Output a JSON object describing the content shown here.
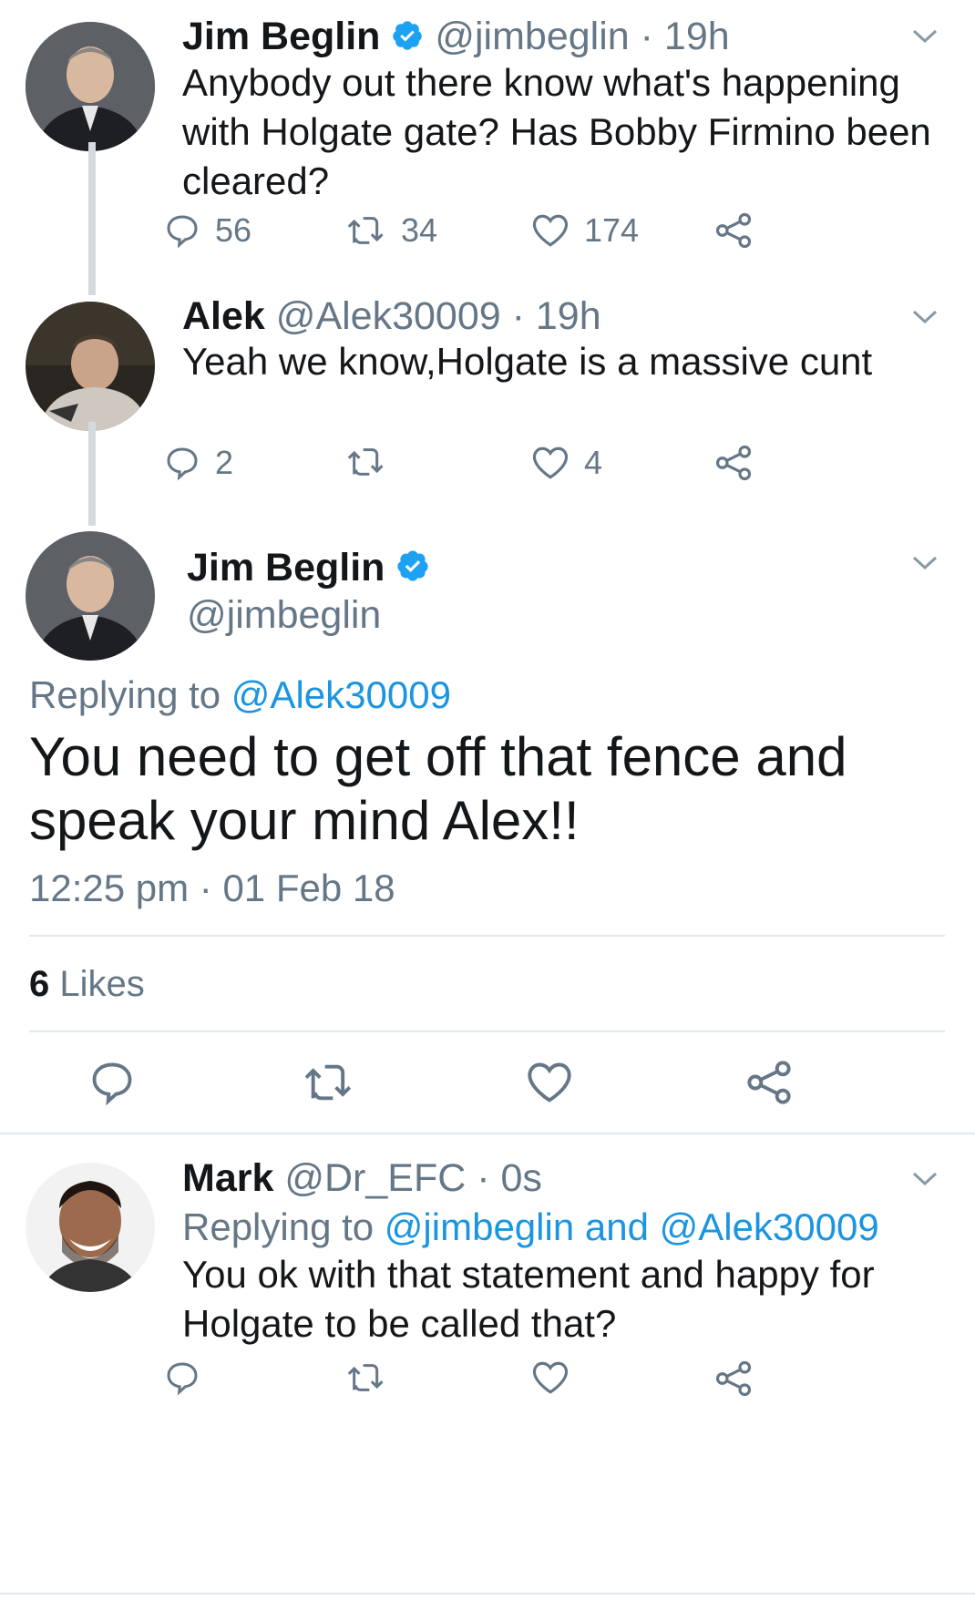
{
  "tweets": [
    {
      "name": "Jim Beglin",
      "handle": "@jimbeglin",
      "time": "· 19h",
      "text": "Anybody out there know what's happening with Holgate gate? Has Bobby Firmino been cleared?",
      "replies": "56",
      "retweets": "34",
      "likes": "174"
    },
    {
      "name": "Alek",
      "handle": "@Alek30009",
      "time": "· 19h",
      "text": "Yeah we know,Holgate is a massive cunt",
      "replies": "2",
      "retweets": "",
      "likes": "4"
    }
  ],
  "focused": {
    "name": "Jim Beglin",
    "handle": "@jimbeglin",
    "replying_label": "Replying to",
    "replying_to": "@Alek30009",
    "text": "You need to get off that fence and speak your mind Alex!!",
    "timestamp": "12:25 pm · 01 Feb 18",
    "likes_count": "6",
    "likes_label": "Likes"
  },
  "reply": {
    "name": "Mark",
    "handle": "@Dr_EFC",
    "time": "· 0s",
    "replying_label": "Replying to",
    "replying_to": "@jimbeglin and @Alek30009",
    "text": "You ok with that statement and happy for Holgate to be called that?"
  },
  "colors": {
    "accent": "#1b95e0",
    "muted": "#657786",
    "verified": "#1da1f2"
  },
  "icons": [
    "reply-icon",
    "retweet-icon",
    "like-icon",
    "share-icon",
    "chevron-down-icon",
    "verified-badge-icon"
  ]
}
